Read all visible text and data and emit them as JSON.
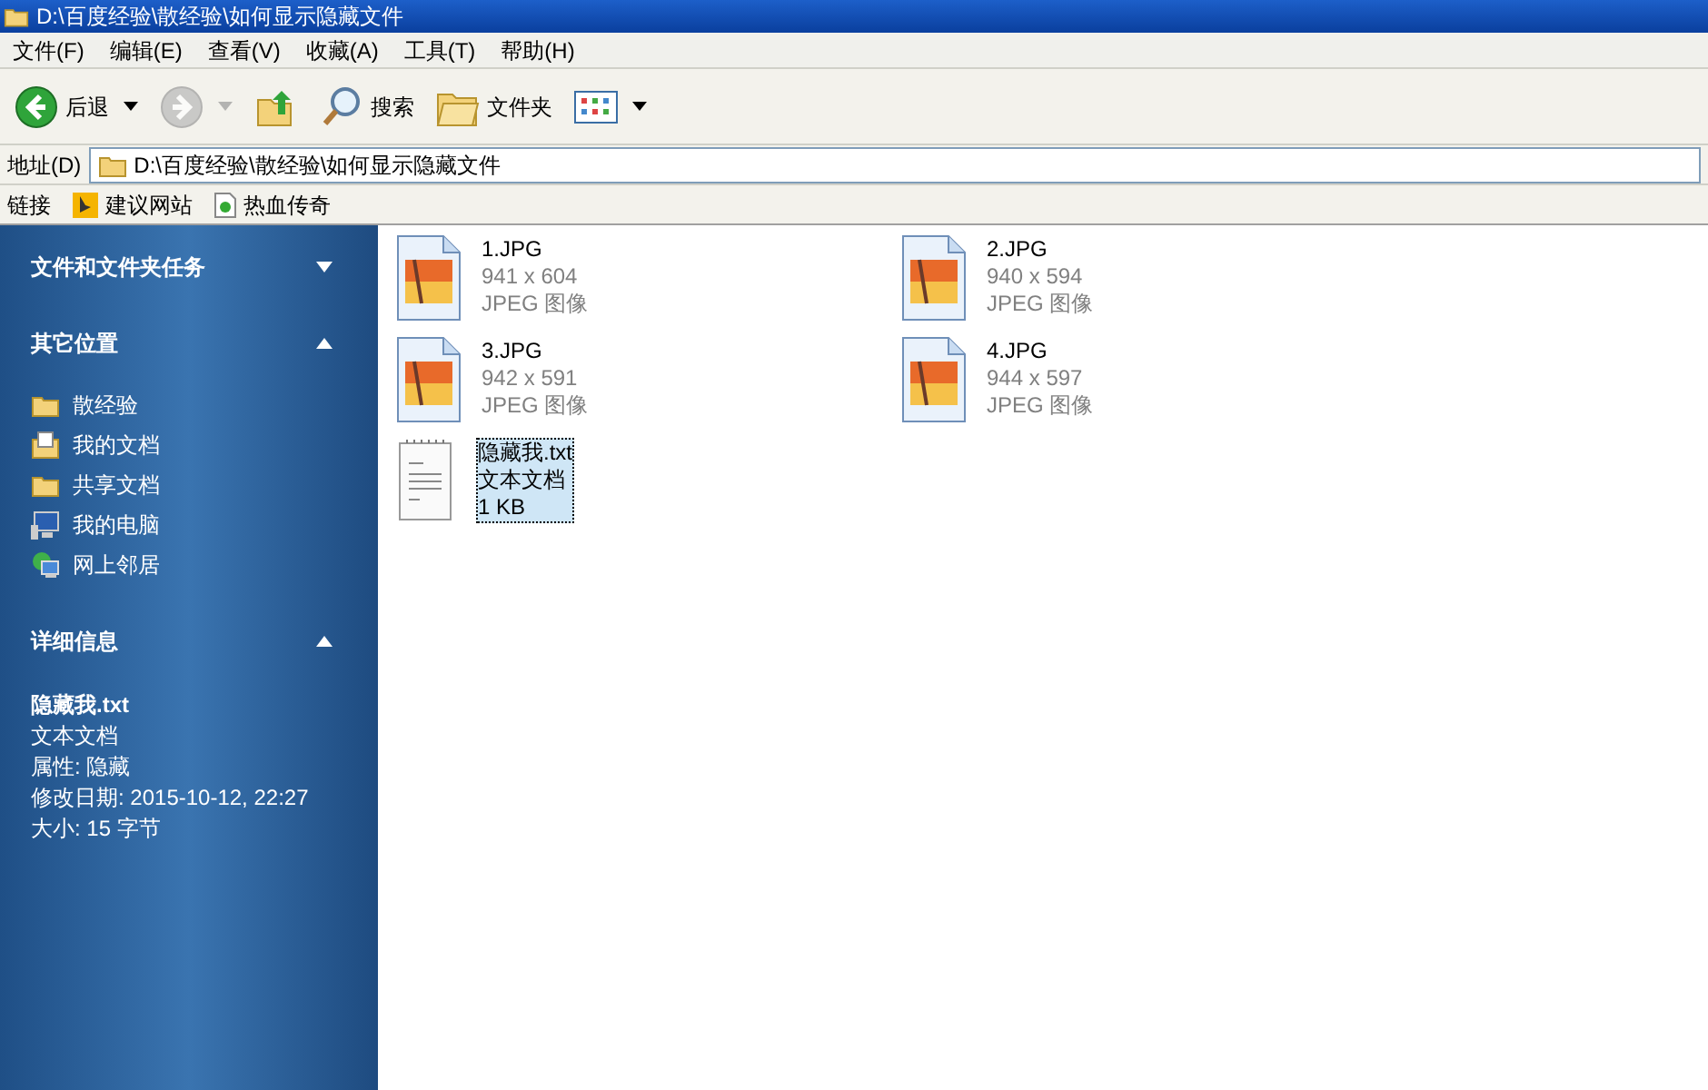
{
  "window": {
    "title": "D:\\百度经验\\散经验\\如何显示隐藏文件"
  },
  "menu": [
    "文件(F)",
    "编辑(E)",
    "查看(V)",
    "收藏(A)",
    "工具(T)",
    "帮助(H)"
  ],
  "toolbar": [
    {
      "kind": "back",
      "label": "后退",
      "disabled": false
    },
    {
      "kind": "forward",
      "disabled": true
    },
    {
      "kind": "up",
      "disabled": false
    },
    {
      "kind": "search",
      "label": "搜索",
      "disabled": false
    },
    {
      "kind": "folders",
      "label": "文件夹",
      "disabled": false
    },
    {
      "kind": "views",
      "disabled": false
    }
  ],
  "address": {
    "label": "地址(D)",
    "value": "D:\\百度经验\\散经验\\如何显示隐藏文件"
  },
  "links": {
    "label": "链接",
    "items": [
      {
        "kind": "bing",
        "label": "建议网站"
      },
      {
        "kind": "page",
        "label": "热血传奇"
      }
    ]
  },
  "sidebar": [
    {
      "title": "文件和文件夹任务",
      "expanded": false
    },
    {
      "title": "其它位置",
      "expanded": true,
      "items": [
        {
          "kind": "folder",
          "label": "散经验"
        },
        {
          "kind": "documents",
          "label": "我的文档"
        },
        {
          "kind": "folder",
          "label": "共享文档"
        },
        {
          "kind": "computer",
          "label": "我的电脑"
        },
        {
          "kind": "network",
          "label": "网上邻居"
        }
      ]
    },
    {
      "title": "详细信息",
      "expanded": true,
      "details": {
        "name": "隐藏我.txt",
        "lines": [
          "文本文档",
          "属性: 隐藏",
          "修改日期: 2015-10-12, 22:27",
          "大小: 15 字节"
        ]
      }
    }
  ],
  "files": [
    {
      "kind": "image",
      "name": "1.JPG",
      "line_2": "941 x 604",
      "line_3": "JPEG 图像",
      "selected": false
    },
    {
      "kind": "image",
      "name": "2.JPG",
      "line_2": "940 x 594",
      "line_3": "JPEG 图像",
      "selected": false
    },
    {
      "kind": "image",
      "name": "3.JPG",
      "line_2": "942 x 591",
      "line_3": "JPEG 图像",
      "selected": false
    },
    {
      "kind": "image",
      "name": "4.JPG",
      "line_2": "944 x 597",
      "line_3": "JPEG 图像",
      "selected": false
    },
    {
      "kind": "text",
      "name": "隐藏我.txt",
      "line_2": "文本文档",
      "line_3": "1 KB",
      "selected": true
    }
  ]
}
